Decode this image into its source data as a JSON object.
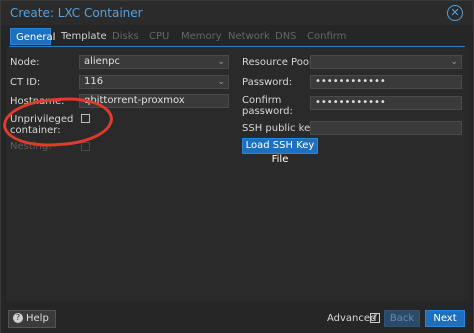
{
  "window": {
    "title": "Create: LXC Container"
  },
  "tabs": [
    {
      "label": "General"
    },
    {
      "label": "Template"
    },
    {
      "label": "Disks"
    },
    {
      "label": "CPU"
    },
    {
      "label": "Memory"
    },
    {
      "label": "Network"
    },
    {
      "label": "DNS"
    },
    {
      "label": "Confirm"
    }
  ],
  "form": {
    "node_label": "Node:",
    "node_value": "alienpc",
    "ctid_label": "CT ID:",
    "ctid_value": "116",
    "hostname_label": "Hostname:",
    "hostname_value": "qbittorrent-proxmox",
    "unprivileged_label": "Unprivileged container:",
    "nesting_label": "Nesting:",
    "resource_pool_label": "Resource Pool:",
    "resource_pool_value": "",
    "password_label": "Password:",
    "password_value": "••••••••••••",
    "confirm_password_label": "Confirm password:",
    "confirm_password_value": "••••••••••••",
    "ssh_label": "SSH public key:",
    "ssh_value": "",
    "load_ssh_label": "Load SSH Key File"
  },
  "footer": {
    "help_label": "Help",
    "advanced_label": "Advanced",
    "back_label": "Back",
    "next_label": "Next"
  },
  "colors": {
    "accent": "#1d6fbf",
    "title": "#4fa3e6",
    "annotation": "#e13b2b"
  },
  "icons": {
    "close": "close-circle-icon",
    "help": "question-icon",
    "dropdown": "chevron-down-icon",
    "check": "checkmark-icon"
  }
}
